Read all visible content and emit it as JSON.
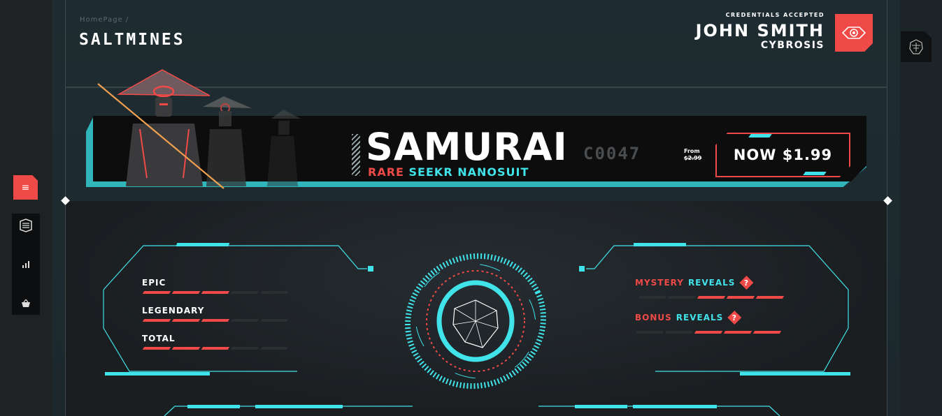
{
  "breadcrumb": "HomePage /",
  "logo": "SALTMINES",
  "user": {
    "status": "CREDENTIALS ACCEPTED",
    "name": "JOHN SMITH",
    "faction": "CYBROSIS"
  },
  "banner": {
    "product_name": "SAMURAI",
    "product_code": "C0047",
    "rarity": "RARE",
    "type": "SEEKR NANOSUIT",
    "from_label": "From",
    "old_price": "$2.99",
    "price": "NOW $1.99"
  },
  "stats": [
    {
      "label": "EPIC",
      "filled": 3,
      "total": 5
    },
    {
      "label": "LEGENDARY",
      "filled": 3,
      "total": 5
    },
    {
      "label": "TOTAL",
      "filled": 3,
      "total": 5
    }
  ],
  "reveals": [
    {
      "word1": "MYSTERY",
      "word2": "REVEALS",
      "badge": "?",
      "filled": 3,
      "total": 5
    },
    {
      "word1": "BONUS",
      "word2": "REVEALS",
      "badge": "?",
      "filled": 3,
      "total": 5
    }
  ],
  "colors": {
    "accent_red": "#ef4a47",
    "accent_cyan": "#41e3ea",
    "panel_dark": "#0d0e0f"
  },
  "icons": {
    "menu": "hamburger-icon",
    "nav": [
      "inventory-box-icon",
      "bar-chart-icon",
      "shop-basket-icon"
    ],
    "user_badge": "eye-icon",
    "side_profile": "helmet-icon"
  }
}
